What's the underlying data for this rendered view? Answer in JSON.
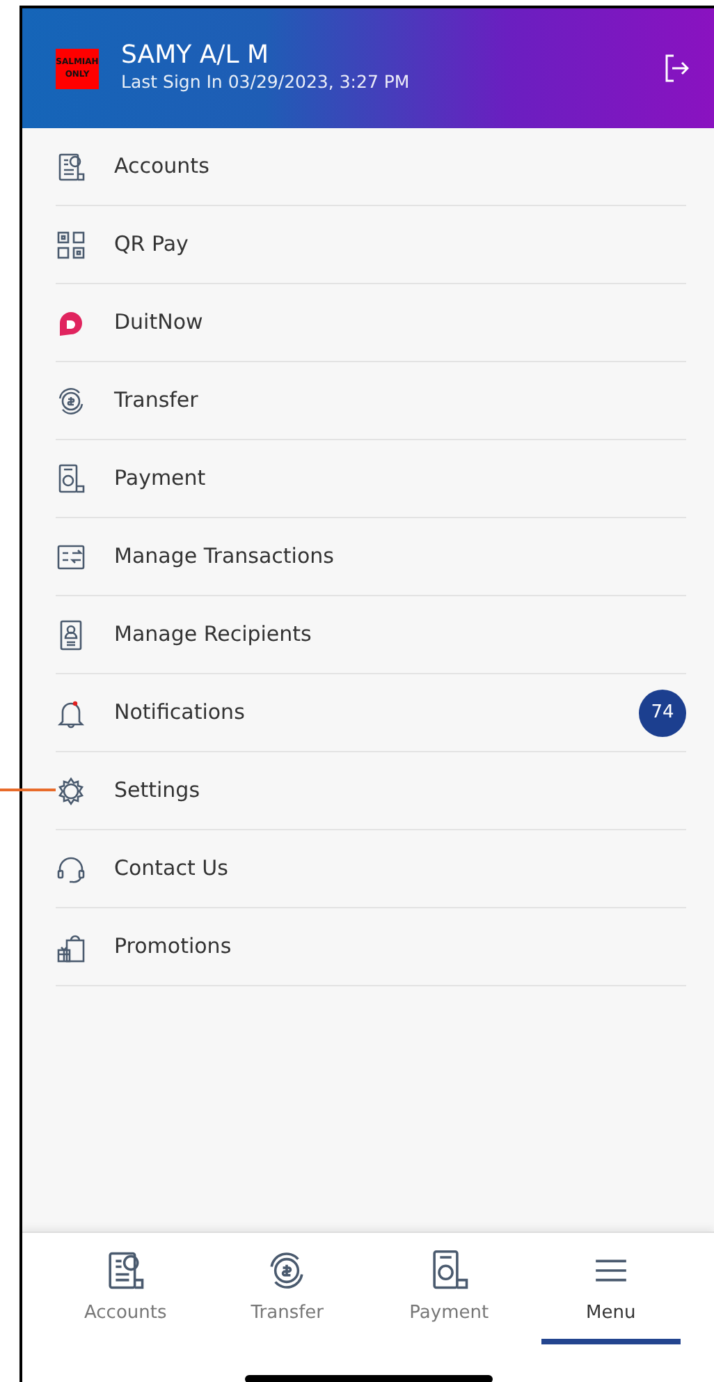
{
  "header": {
    "logo_text": "SALMIAH ONLY",
    "name": "SAMY A/L M",
    "last_sign_in": "Last Sign In 03/29/2023, 3:27 PM"
  },
  "menu": [
    {
      "label": "Accounts"
    },
    {
      "label": "QR Pay"
    },
    {
      "label": "DuitNow"
    },
    {
      "label": "Transfer"
    },
    {
      "label": "Payment"
    },
    {
      "label": "Manage Transactions"
    },
    {
      "label": "Manage Recipients"
    },
    {
      "label": "Notifications",
      "badge": "74"
    },
    {
      "label": "Settings"
    },
    {
      "label": "Contact Us"
    },
    {
      "label": "Promotions"
    }
  ],
  "bottom_nav": [
    {
      "label": "Accounts",
      "selected": false
    },
    {
      "label": "Transfer",
      "selected": false
    },
    {
      "label": "Payment",
      "selected": false
    },
    {
      "label": "Menu",
      "selected": true
    }
  ]
}
